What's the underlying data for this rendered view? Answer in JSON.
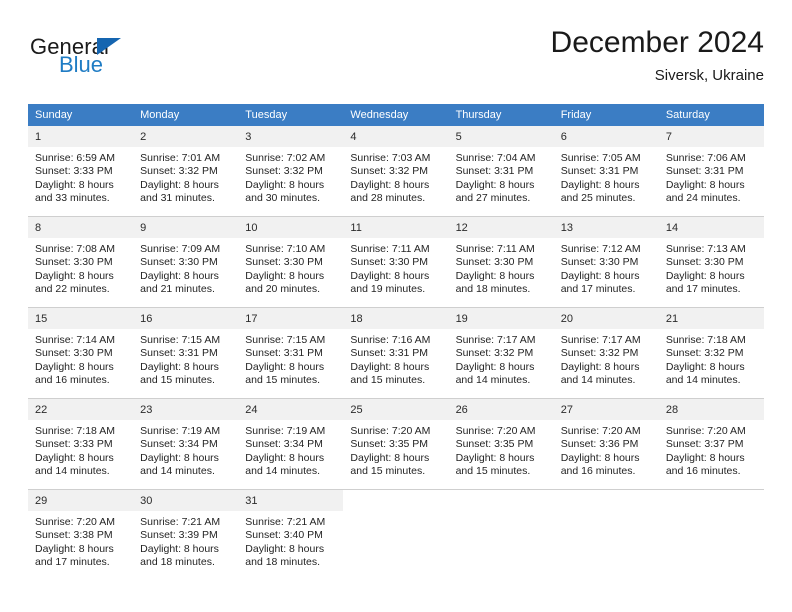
{
  "brand": {
    "name_dark": "General",
    "name_blue": "Blue",
    "accent_color": "#1f7cc4",
    "triangle_color": "#1565b0"
  },
  "header": {
    "title": "December 2024",
    "subtitle": "Siversk, Ukraine",
    "header_bg": "#3b7dc4",
    "daynum_bg": "#f1f1f1"
  },
  "weekdays": [
    "Sunday",
    "Monday",
    "Tuesday",
    "Wednesday",
    "Thursday",
    "Friday",
    "Saturday"
  ],
  "labels": {
    "sunrise": "Sunrise:",
    "sunset": "Sunset:",
    "daylight": "Daylight:"
  },
  "weeks": [
    [
      {
        "day": "1",
        "sunrise": "Sunrise: 6:59 AM",
        "sunset": "Sunset: 3:33 PM",
        "daylight1": "Daylight: 8 hours",
        "daylight2": "and 33 minutes."
      },
      {
        "day": "2",
        "sunrise": "Sunrise: 7:01 AM",
        "sunset": "Sunset: 3:32 PM",
        "daylight1": "Daylight: 8 hours",
        "daylight2": "and 31 minutes."
      },
      {
        "day": "3",
        "sunrise": "Sunrise: 7:02 AM",
        "sunset": "Sunset: 3:32 PM",
        "daylight1": "Daylight: 8 hours",
        "daylight2": "and 30 minutes."
      },
      {
        "day": "4",
        "sunrise": "Sunrise: 7:03 AM",
        "sunset": "Sunset: 3:32 PM",
        "daylight1": "Daylight: 8 hours",
        "daylight2": "and 28 minutes."
      },
      {
        "day": "5",
        "sunrise": "Sunrise: 7:04 AM",
        "sunset": "Sunset: 3:31 PM",
        "daylight1": "Daylight: 8 hours",
        "daylight2": "and 27 minutes."
      },
      {
        "day": "6",
        "sunrise": "Sunrise: 7:05 AM",
        "sunset": "Sunset: 3:31 PM",
        "daylight1": "Daylight: 8 hours",
        "daylight2": "and 25 minutes."
      },
      {
        "day": "7",
        "sunrise": "Sunrise: 7:06 AM",
        "sunset": "Sunset: 3:31 PM",
        "daylight1": "Daylight: 8 hours",
        "daylight2": "and 24 minutes."
      }
    ],
    [
      {
        "day": "8",
        "sunrise": "Sunrise: 7:08 AM",
        "sunset": "Sunset: 3:30 PM",
        "daylight1": "Daylight: 8 hours",
        "daylight2": "and 22 minutes."
      },
      {
        "day": "9",
        "sunrise": "Sunrise: 7:09 AM",
        "sunset": "Sunset: 3:30 PM",
        "daylight1": "Daylight: 8 hours",
        "daylight2": "and 21 minutes."
      },
      {
        "day": "10",
        "sunrise": "Sunrise: 7:10 AM",
        "sunset": "Sunset: 3:30 PM",
        "daylight1": "Daylight: 8 hours",
        "daylight2": "and 20 minutes."
      },
      {
        "day": "11",
        "sunrise": "Sunrise: 7:11 AM",
        "sunset": "Sunset: 3:30 PM",
        "daylight1": "Daylight: 8 hours",
        "daylight2": "and 19 minutes."
      },
      {
        "day": "12",
        "sunrise": "Sunrise: 7:11 AM",
        "sunset": "Sunset: 3:30 PM",
        "daylight1": "Daylight: 8 hours",
        "daylight2": "and 18 minutes."
      },
      {
        "day": "13",
        "sunrise": "Sunrise: 7:12 AM",
        "sunset": "Sunset: 3:30 PM",
        "daylight1": "Daylight: 8 hours",
        "daylight2": "and 17 minutes."
      },
      {
        "day": "14",
        "sunrise": "Sunrise: 7:13 AM",
        "sunset": "Sunset: 3:30 PM",
        "daylight1": "Daylight: 8 hours",
        "daylight2": "and 17 minutes."
      }
    ],
    [
      {
        "day": "15",
        "sunrise": "Sunrise: 7:14 AM",
        "sunset": "Sunset: 3:30 PM",
        "daylight1": "Daylight: 8 hours",
        "daylight2": "and 16 minutes."
      },
      {
        "day": "16",
        "sunrise": "Sunrise: 7:15 AM",
        "sunset": "Sunset: 3:31 PM",
        "daylight1": "Daylight: 8 hours",
        "daylight2": "and 15 minutes."
      },
      {
        "day": "17",
        "sunrise": "Sunrise: 7:15 AM",
        "sunset": "Sunset: 3:31 PM",
        "daylight1": "Daylight: 8 hours",
        "daylight2": "and 15 minutes."
      },
      {
        "day": "18",
        "sunrise": "Sunrise: 7:16 AM",
        "sunset": "Sunset: 3:31 PM",
        "daylight1": "Daylight: 8 hours",
        "daylight2": "and 15 minutes."
      },
      {
        "day": "19",
        "sunrise": "Sunrise: 7:17 AM",
        "sunset": "Sunset: 3:32 PM",
        "daylight1": "Daylight: 8 hours",
        "daylight2": "and 14 minutes."
      },
      {
        "day": "20",
        "sunrise": "Sunrise: 7:17 AM",
        "sunset": "Sunset: 3:32 PM",
        "daylight1": "Daylight: 8 hours",
        "daylight2": "and 14 minutes."
      },
      {
        "day": "21",
        "sunrise": "Sunrise: 7:18 AM",
        "sunset": "Sunset: 3:32 PM",
        "daylight1": "Daylight: 8 hours",
        "daylight2": "and 14 minutes."
      }
    ],
    [
      {
        "day": "22",
        "sunrise": "Sunrise: 7:18 AM",
        "sunset": "Sunset: 3:33 PM",
        "daylight1": "Daylight: 8 hours",
        "daylight2": "and 14 minutes."
      },
      {
        "day": "23",
        "sunrise": "Sunrise: 7:19 AM",
        "sunset": "Sunset: 3:34 PM",
        "daylight1": "Daylight: 8 hours",
        "daylight2": "and 14 minutes."
      },
      {
        "day": "24",
        "sunrise": "Sunrise: 7:19 AM",
        "sunset": "Sunset: 3:34 PM",
        "daylight1": "Daylight: 8 hours",
        "daylight2": "and 14 minutes."
      },
      {
        "day": "25",
        "sunrise": "Sunrise: 7:20 AM",
        "sunset": "Sunset: 3:35 PM",
        "daylight1": "Daylight: 8 hours",
        "daylight2": "and 15 minutes."
      },
      {
        "day": "26",
        "sunrise": "Sunrise: 7:20 AM",
        "sunset": "Sunset: 3:35 PM",
        "daylight1": "Daylight: 8 hours",
        "daylight2": "and 15 minutes."
      },
      {
        "day": "27",
        "sunrise": "Sunrise: 7:20 AM",
        "sunset": "Sunset: 3:36 PM",
        "daylight1": "Daylight: 8 hours",
        "daylight2": "and 16 minutes."
      },
      {
        "day": "28",
        "sunrise": "Sunrise: 7:20 AM",
        "sunset": "Sunset: 3:37 PM",
        "daylight1": "Daylight: 8 hours",
        "daylight2": "and 16 minutes."
      }
    ],
    [
      {
        "day": "29",
        "sunrise": "Sunrise: 7:20 AM",
        "sunset": "Sunset: 3:38 PM",
        "daylight1": "Daylight: 8 hours",
        "daylight2": "and 17 minutes."
      },
      {
        "day": "30",
        "sunrise": "Sunrise: 7:21 AM",
        "sunset": "Sunset: 3:39 PM",
        "daylight1": "Daylight: 8 hours",
        "daylight2": "and 18 minutes."
      },
      {
        "day": "31",
        "sunrise": "Sunrise: 7:21 AM",
        "sunset": "Sunset: 3:40 PM",
        "daylight1": "Daylight: 8 hours",
        "daylight2": "and 18 minutes."
      },
      {
        "day": "",
        "sunrise": "",
        "sunset": "",
        "daylight1": "",
        "daylight2": ""
      },
      {
        "day": "",
        "sunrise": "",
        "sunset": "",
        "daylight1": "",
        "daylight2": ""
      },
      {
        "day": "",
        "sunrise": "",
        "sunset": "",
        "daylight1": "",
        "daylight2": ""
      },
      {
        "day": "",
        "sunrise": "",
        "sunset": "",
        "daylight1": "",
        "daylight2": ""
      }
    ]
  ]
}
